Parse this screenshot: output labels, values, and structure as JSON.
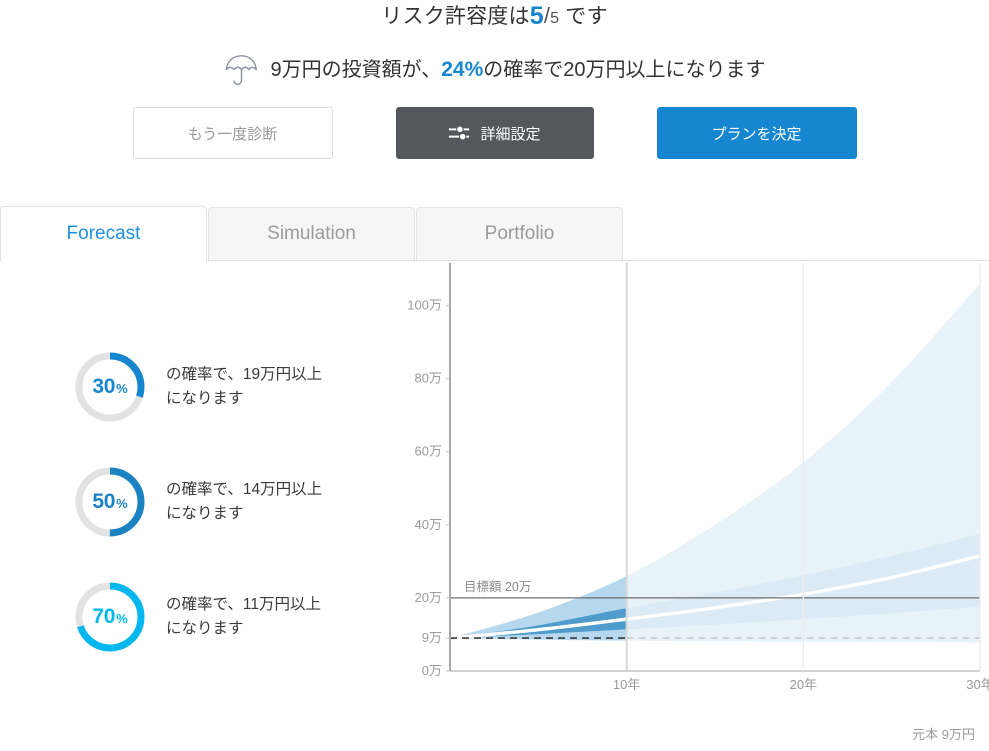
{
  "header": {
    "risk_prefix": "リスク許容度は",
    "risk_value": "5",
    "risk_sep": "/",
    "risk_max": "5",
    "risk_suffix": "です",
    "umbrella_icon": "umbrella-icon",
    "sub_prefix": "9万円の投資額が、",
    "sub_probability": "24%",
    "sub_suffix": "の確率で20万円以上になります"
  },
  "buttons": {
    "redo_label": "もう一度診断",
    "detail_label": "詳細設定",
    "detail_icon": "sliders-icon",
    "decide_label": "プランを決定"
  },
  "tabs": [
    {
      "label": "Forecast",
      "active": true
    },
    {
      "label": "Simulation",
      "active": false
    },
    {
      "label": "Portfolio",
      "active": false
    }
  ],
  "gauges": [
    {
      "value": "30",
      "pct_symbol": "%",
      "percent": 30,
      "color": "#1686d0",
      "track_color": "#e2e2e2",
      "text_line1": "の確率で、19万円以上",
      "text_line2": "になります"
    },
    {
      "value": "50",
      "pct_symbol": "%",
      "percent": 50,
      "color": "#1b83c2",
      "track_color": "#e2e2e2",
      "text_line1": "の確率で、14万円以上",
      "text_line2": "になります"
    },
    {
      "value": "70",
      "pct_symbol": "%",
      "percent": 70,
      "color": "#00b7ef",
      "track_color": "#e2e2e2",
      "text_line1": "の確率で、11万円以上",
      "text_line2": "になります"
    }
  ],
  "footer": {
    "principal_note": "元本 9万円"
  },
  "chart_data": {
    "type": "area",
    "title": "",
    "xlabel": "",
    "ylabel": "",
    "xlim": [
      0,
      30
    ],
    "ylim": [
      0,
      110
    ],
    "x_unit": "年",
    "y_unit": "万",
    "x_ticks": [
      10,
      20,
      30
    ],
    "x_tick_labels": [
      "10年",
      "20年",
      "30年"
    ],
    "y_ticks": [
      0,
      9,
      20,
      40,
      60,
      80,
      100
    ],
    "y_tick_labels": [
      "0万",
      "9万",
      "20万",
      "40万",
      "60万",
      "80万",
      "100万"
    ],
    "grid": false,
    "legend": null,
    "highlight_x": 10,
    "annotations": [
      {
        "name": "target-line",
        "label": "目標額 20万",
        "y": 20,
        "style": "solid",
        "color": "#555555"
      },
      {
        "name": "principal-line",
        "label": "元本 9万円",
        "y": 9,
        "style": "dashed",
        "color": "#444444"
      }
    ],
    "x": [
      0,
      5,
      10,
      15,
      20,
      25,
      30
    ],
    "series": [
      {
        "name": "outer-band-upper",
        "role": "band_upper",
        "opacity_low": 0.18,
        "color": "#bcdcf0",
        "values": [
          9,
          16,
          26,
          40,
          57,
          79,
          106
        ]
      },
      {
        "name": "outer-band-lower",
        "role": "band_lower",
        "color": "#bcdcf0",
        "values": [
          9,
          8.6,
          8.3,
          8.1,
          8.0,
          7.9,
          7.8
        ]
      },
      {
        "name": "inner-band-upper",
        "role": "band_upper",
        "color": "#5a9ec9",
        "values": [
          9,
          12.5,
          17.2,
          21.5,
          26.2,
          31.5,
          37.5
        ]
      },
      {
        "name": "inner-band-lower",
        "role": "band_lower",
        "color": "#5a9ec9",
        "values": [
          9,
          10.1,
          11.4,
          12.7,
          14.2,
          15.8,
          17.6
        ]
      },
      {
        "name": "median",
        "role": "line",
        "color": "#ffffff",
        "values": [
          9,
          11.3,
          14.2,
          17.3,
          21.0,
          25.6,
          31.5
        ]
      }
    ]
  }
}
